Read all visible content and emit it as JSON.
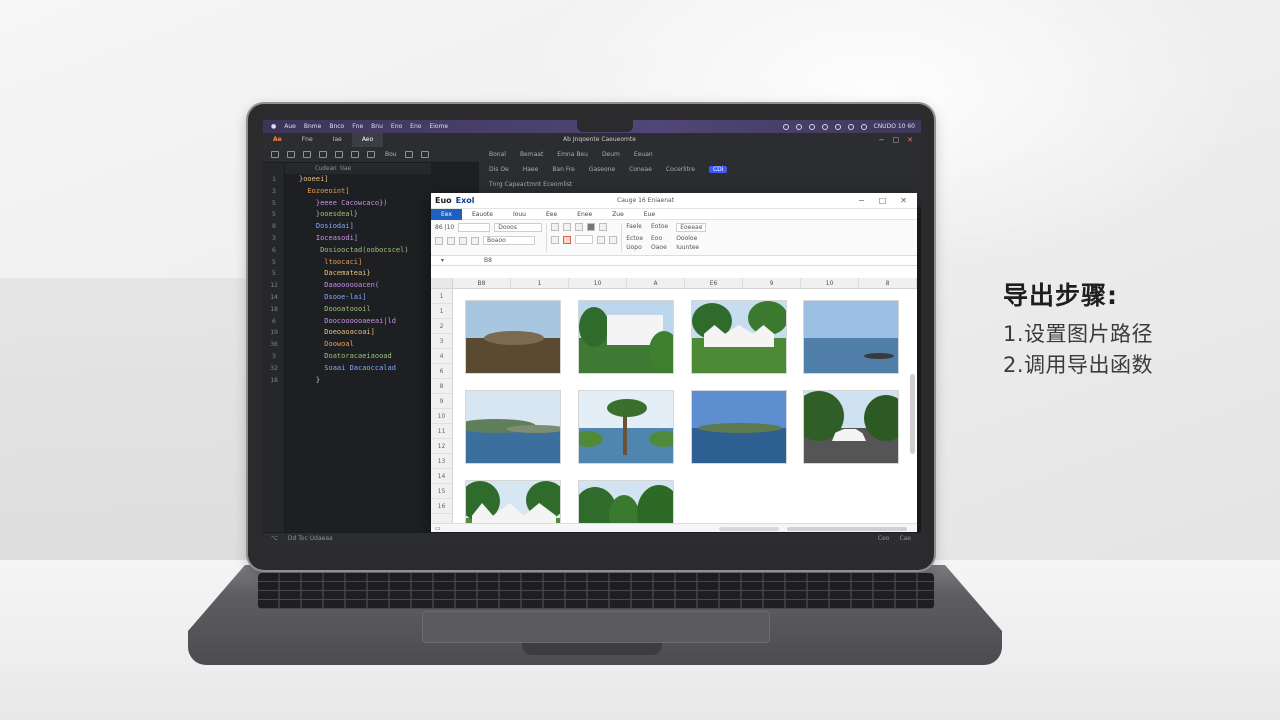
{
  "side_panel": {
    "title": "导出步骤:",
    "steps": [
      "1.设置图片路径",
      "2.调用导出函数"
    ]
  },
  "menubar": {
    "items": [
      "Aue",
      "Bnme",
      "Bnco",
      "Fne",
      "Bnu",
      "Eno",
      "Eno",
      "Eiome"
    ],
    "right_status": "CNUDO 10 60"
  },
  "ide": {
    "tabs": [
      "Ae",
      "Fne",
      "Iae",
      "Aeo"
    ],
    "window_title": "Ab Jnqoente Caeueomte",
    "toolbar_text": "Bou",
    "code_header": "Cudean Uae",
    "right_header": [
      "Bonal",
      "Bemaat",
      "Emna Beu",
      "Deum",
      "Eeuan"
    ],
    "right_row2": [
      "Dis Oe",
      "Haee",
      "Ban Fre",
      "Gaseone",
      "Coneae",
      "Cocerlitre"
    ],
    "right_badge": "CDi",
    "right_row3": "Tnrg Capeactmnt Eceomlist",
    "line_numbers": [
      "1",
      "3",
      "5",
      "5",
      "8",
      "3",
      "6",
      "5",
      "5",
      "12",
      "14",
      "18",
      "6",
      "19",
      "36",
      "3",
      "32",
      "18"
    ],
    "code_lines": [
      "}ooeei]",
      "  Eozoeoint]",
      "    }eeee Cacowcaco})",
      "    }ooesdeal}",
      "    Dosiodai]",
      "    Ioceasodi]",
      "     Dosiooctad(oobocscel)",
      "      ltoocaci]",
      "      Dacemateai}",
      "      Daaoooooacen(",
      "      Dsooe-lai]",
      "      Doooatoooil",
      "      Doocoooooaeeai|ld",
      "      Doeoaoacoai]",
      "      Doowoal",
      "      Doatoracaeiaooad",
      "      Soaai Dacaoccalad",
      "    }"
    ],
    "status_left": "Dd Toc Udaeaa",
    "status_right": [
      "Ceo",
      "Cae"
    ]
  },
  "excel": {
    "logo_left": "Euo",
    "logo_right": "Exol",
    "window_title": "Cauge 16 Eniaenat",
    "ribbon_tabs": [
      "Eex",
      "Eauote",
      "Iouu",
      "Eee",
      "Enee",
      "Zue",
      "Eue"
    ],
    "ribbon": {
      "font_size": "86 |10",
      "font_name": "Dooos",
      "number_fmt": "Boaoo",
      "right_labels": [
        "Faele",
        "Eotoe",
        "Eoeeae",
        "Ectoe",
        "Eoo",
        "Oooloe",
        "Uopo",
        "Oaoe",
        "Erro",
        "Iuuntee"
      ]
    },
    "cell_ref": "B8",
    "columns": [
      "B8",
      "1",
      "10",
      "A",
      "E6",
      "9",
      "10",
      "8"
    ],
    "rows": [
      "1",
      "1",
      "2",
      "3",
      "4",
      "6",
      "8",
      "9",
      "10",
      "11",
      "12",
      "13",
      "14",
      "15",
      "16"
    ]
  },
  "photos": [
    {
      "name": "photo-lake-mountain",
      "sky": "#a8c6e0",
      "ground": "#5a4a32"
    },
    {
      "name": "photo-white-building",
      "sky": "#bcd6ee",
      "ground": "#3f7a34"
    },
    {
      "name": "photo-tent-garden",
      "sky": "#c7dcf0",
      "ground": "#4d8a35"
    },
    {
      "name": "photo-sea-horizon",
      "sky": "#9cc0e4",
      "ground": "#4f7fa8"
    },
    {
      "name": "photo-bay-coast",
      "sky": "#d8e6f2",
      "ground": "#3a6f9e"
    },
    {
      "name": "photo-palm-beach",
      "sky": "#e4eef6",
      "ground": "#4f86b0"
    },
    {
      "name": "photo-blue-lake",
      "sky": "#5d8fd0",
      "ground": "#2d5f93"
    },
    {
      "name": "photo-white-car-road",
      "sky": "#cfe2f2",
      "ground": "#555"
    },
    {
      "name": "photo-tents-lawn",
      "sky": "#d6e6f3",
      "ground": "#4f8b38"
    },
    {
      "name": "photo-tropical-trees",
      "sky": "#d2e4f2",
      "ground": "#3e7a30"
    }
  ],
  "colors": {
    "menubar_purple": "#514677",
    "excel_blue": "#1f5fbf",
    "ide_dark": "#1e1f22"
  }
}
